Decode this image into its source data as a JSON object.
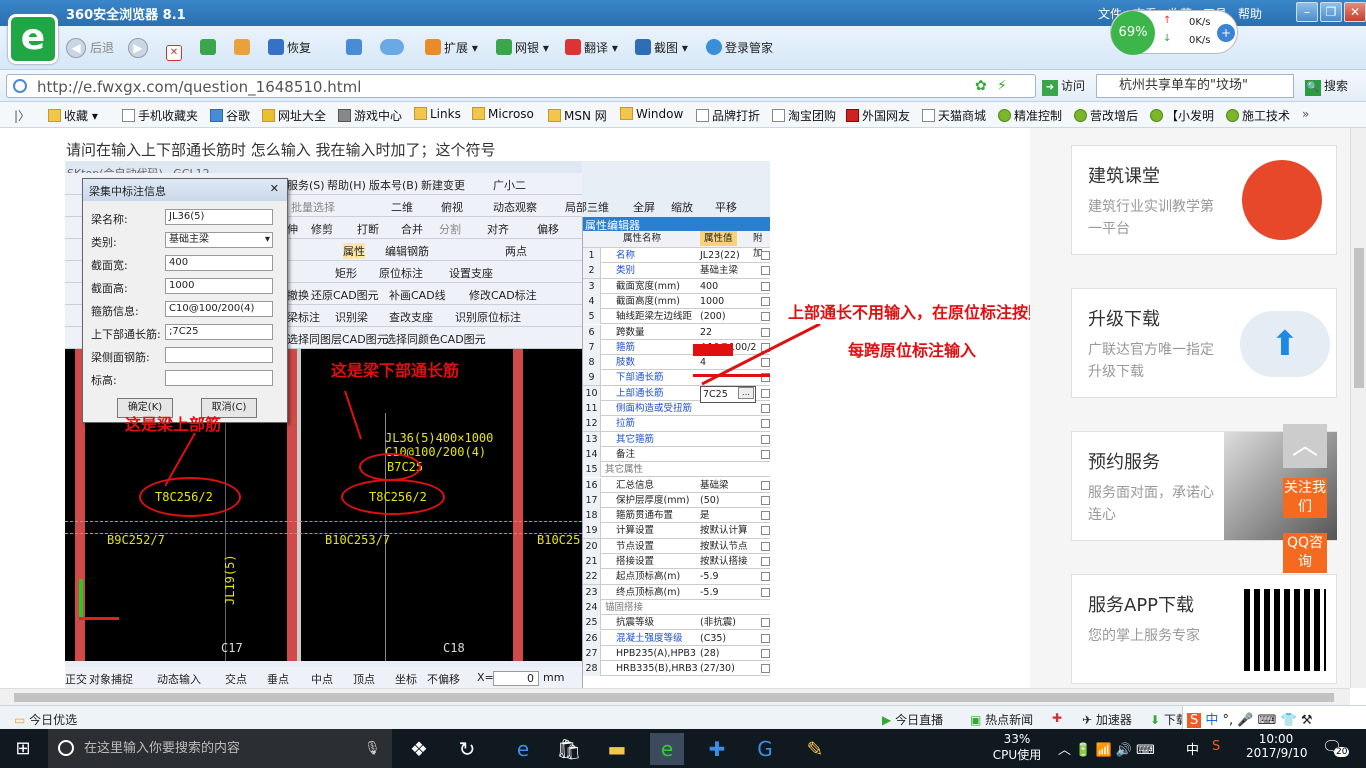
{
  "browser": {
    "title": "360安全浏览器 8.1",
    "menu": [
      "文件",
      "查看",
      "收藏",
      "工具",
      "帮助"
    ],
    "speed": {
      "percent": "69%",
      "up": "0K/s",
      "down": "0K/s"
    },
    "toolbar": {
      "back": "后退",
      "restore": "恢复",
      "extend": "扩展",
      "bank": "网银",
      "translate": "翻译",
      "screenshot": "截图",
      "login": "登录管家"
    },
    "url": "http://e.fwxgx.com/question_1648510.html",
    "visit": "访问",
    "search_text": "杭州共享单车的\"坟场\"",
    "search_btn": "搜索",
    "favorites": [
      "收藏",
      "手机收藏夹",
      "谷歌",
      "网址大全",
      "游戏中心",
      "Links",
      "Microso",
      "MSN 网",
      "Window",
      "品牌打折",
      "淘宝团购",
      "外国网友",
      "天猫商城",
      "精准控制",
      "营改增后",
      "【小发明",
      "施工技术"
    ]
  },
  "question": "请问在输入上下部通长筋时 怎么输入 我在输入时加了；这个符号",
  "screenshot": {
    "app_title": "SKtop(会自动代码)...GCL12",
    "menus": [
      "服务(S)",
      "帮助(H)",
      "版本号(B)",
      "新建变更",
      "广小二"
    ],
    "row2": [
      "批量选择",
      "二维",
      "俯视",
      "动态观察",
      "局部三维",
      "全屏",
      "缩放",
      "平移"
    ],
    "row3": [
      "伸",
      "修剪",
      "打断",
      "合并",
      "分割",
      "对齐",
      "偏移"
    ],
    "row4": [
      "属性",
      "编辑钢筋",
      "两点"
    ],
    "row5": [
      "矩形",
      "原位标注",
      "设置支座"
    ],
    "row6": [
      "撤换",
      "还原CAD图元",
      "补画CAD线",
      "修改CAD标注"
    ],
    "row7": [
      "梁标注",
      "识别梁",
      "查改支座",
      "识别原位标注"
    ],
    "row8": [
      "选择同图层CAD图元",
      "选择同颜色CAD图元"
    ],
    "dialog": {
      "title": "梁集中标注信息",
      "fields": [
        {
          "label": "梁名称:",
          "value": "JL36(5)"
        },
        {
          "label": "类别:",
          "value": "基础主梁"
        },
        {
          "label": "截面宽:",
          "value": "400"
        },
        {
          "label": "截面高:",
          "value": "1000"
        },
        {
          "label": "箍筋信息:",
          "value": "C10@100/200(4)"
        },
        {
          "label": "上下部通长筋:",
          "value": ";7C25"
        },
        {
          "label": "梁侧面钢筋:",
          "value": ""
        },
        {
          "label": "标高:",
          "value": ""
        }
      ],
      "ok": "确定(K)",
      "cancel": "取消(C)"
    },
    "prop_header": "属性编辑器",
    "prop_cols": [
      "属性名称",
      "属性值",
      "附加"
    ],
    "props": [
      {
        "n": "1",
        "k": "名称",
        "v": "JL23(22)"
      },
      {
        "n": "2",
        "k": "类别",
        "v": "基础主梁"
      },
      {
        "n": "3",
        "k": "截面宽度(mm)",
        "v": "400"
      },
      {
        "n": "4",
        "k": "截面高度(mm)",
        "v": "1000"
      },
      {
        "n": "5",
        "k": "轴线距梁左边线距",
        "v": "(200)"
      },
      {
        "n": "6",
        "k": "跨数量",
        "v": "22"
      },
      {
        "n": "7",
        "k": "箍筋",
        "v": "Φ10@100/2"
      },
      {
        "n": "8",
        "k": "肢数",
        "v": "4"
      },
      {
        "n": "9",
        "k": "下部通长筋",
        "v": ""
      },
      {
        "n": "10",
        "k": "上部通长筋",
        "v": "7C25"
      },
      {
        "n": "11",
        "k": "侧面构造或受扭筋",
        "v": ""
      },
      {
        "n": "12",
        "k": "拉筋",
        "v": ""
      },
      {
        "n": "13",
        "k": "其它箍筋",
        "v": ""
      },
      {
        "n": "14",
        "k": "备注",
        "v": ""
      },
      {
        "n": "15",
        "k": "其它属性",
        "v": ""
      },
      {
        "n": "16",
        "k": "汇总信息",
        "v": "基础梁"
      },
      {
        "n": "17",
        "k": "保护层厚度(mm)",
        "v": "(50)"
      },
      {
        "n": "18",
        "k": "箍筋贯通布置",
        "v": "是"
      },
      {
        "n": "19",
        "k": "计算设置",
        "v": "按默认计算"
      },
      {
        "n": "20",
        "k": "节点设置",
        "v": "按默认节点"
      },
      {
        "n": "21",
        "k": "搭接设置",
        "v": "按默认搭接"
      },
      {
        "n": "22",
        "k": "起点顶标高(m)",
        "v": "-5.9"
      },
      {
        "n": "23",
        "k": "终点顶标高(m)",
        "v": "-5.9"
      },
      {
        "n": "24",
        "k": "锚固搭接",
        "v": ""
      },
      {
        "n": "25",
        "k": "抗震等级",
        "v": "(非抗震)"
      },
      {
        "n": "26",
        "k": "混凝土强度等级",
        "v": "(C35)"
      },
      {
        "n": "27",
        "k": "HPB235(A),HPB3",
        "v": "(28)"
      },
      {
        "n": "28",
        "k": "HRB335(B),HRB3",
        "v": "(27/30)"
      }
    ],
    "cad_texts": {
      "beam": "JL36(5)400×1000",
      "stirrup": "C10@100/200(4)",
      "b7": "B7C25",
      "t8a": "T8C256/2",
      "t8b": "T8C256/2",
      "b9": "B9C252/7",
      "b10a": "B10C253/7",
      "b10b": "B10C25",
      "c17": "C17",
      "c18": "C18",
      "jl19": "JL19(5)"
    },
    "annotations": {
      "upper": "这是梁上部筋",
      "lower": "这是梁下部通长筋",
      "note1": "上部通长不用输入，在原位标注按照",
      "note2": "每跨原位标注输入"
    },
    "bottom_bar": [
      "正交",
      "对象捕捉",
      "动态输入",
      "交点",
      "垂点",
      "中点",
      "顶点",
      "坐标",
      "不偏移",
      "X=",
      "0",
      "mm"
    ]
  },
  "sidebar": [
    {
      "title": "建筑课堂",
      "desc": "建筑行业实训教学第一平台"
    },
    {
      "title": "升级下载",
      "desc": "广联达官方唯一指定升级下载"
    },
    {
      "title": "预约服务",
      "desc": "服务面对面，承诺心连心"
    },
    {
      "title": "服务APP下载",
      "desc": "您的掌上服务专家"
    }
  ],
  "side_buttons": [
    "关注我们",
    "QQ咨询"
  ],
  "statusbar": {
    "left": "今日优选",
    "live": "今日直播",
    "news": "热点新闻",
    "accel": "加速器",
    "download": "下载"
  },
  "taskbar": {
    "search": "在这里输入你要搜索的内容",
    "cpu": "33%",
    "cpu_label": "CPU使用",
    "ime": "中",
    "time": "10:00",
    "date": "2017/9/10",
    "badge": "20"
  },
  "colors": {
    "accent": "#2b7fd1",
    "annotation": "#e01010",
    "cad_bg": "#000000",
    "cad_text": "#e6e600"
  }
}
